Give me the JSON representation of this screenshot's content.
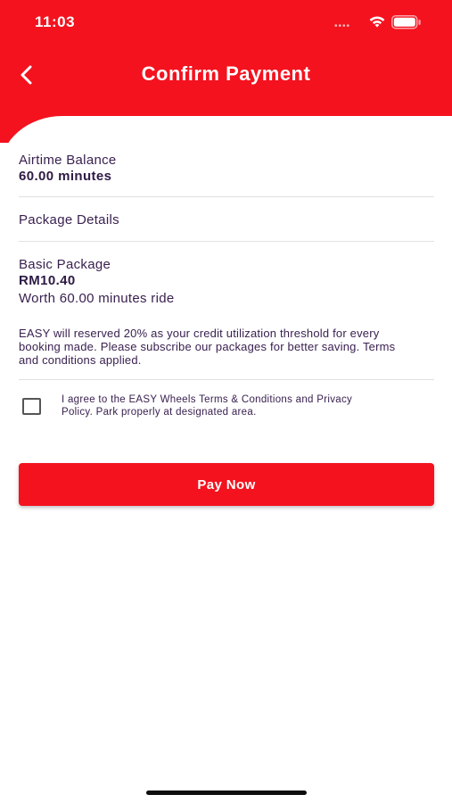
{
  "status_bar": {
    "time": "11:03",
    "signal_icon": "signal-dots-icon",
    "wifi_icon": "wifi-icon",
    "battery_icon": "battery-icon"
  },
  "header": {
    "title": "Confirm Payment",
    "back_icon": "chevron-left-icon",
    "background_color": "#f4121e"
  },
  "airtime": {
    "label": "Airtime Balance",
    "value": "60.00 minutes"
  },
  "package_details": {
    "label": "Package Details"
  },
  "package": {
    "name": "Basic Package",
    "price": "RM10.40",
    "worth": "Worth 60.00 minutes ride"
  },
  "note": {
    "text": "EASY will reserved 20% as your credit utilization threshold for every booking made. Please subscribe our packages for better saving. Terms and conditions applied."
  },
  "agreement": {
    "checked": false,
    "text": "I agree to the EASY Wheels Terms & Conditions and Privacy Policy. Park properly at designated area."
  },
  "actions": {
    "pay_label": "Pay Now",
    "accent_color": "#f4121e"
  }
}
